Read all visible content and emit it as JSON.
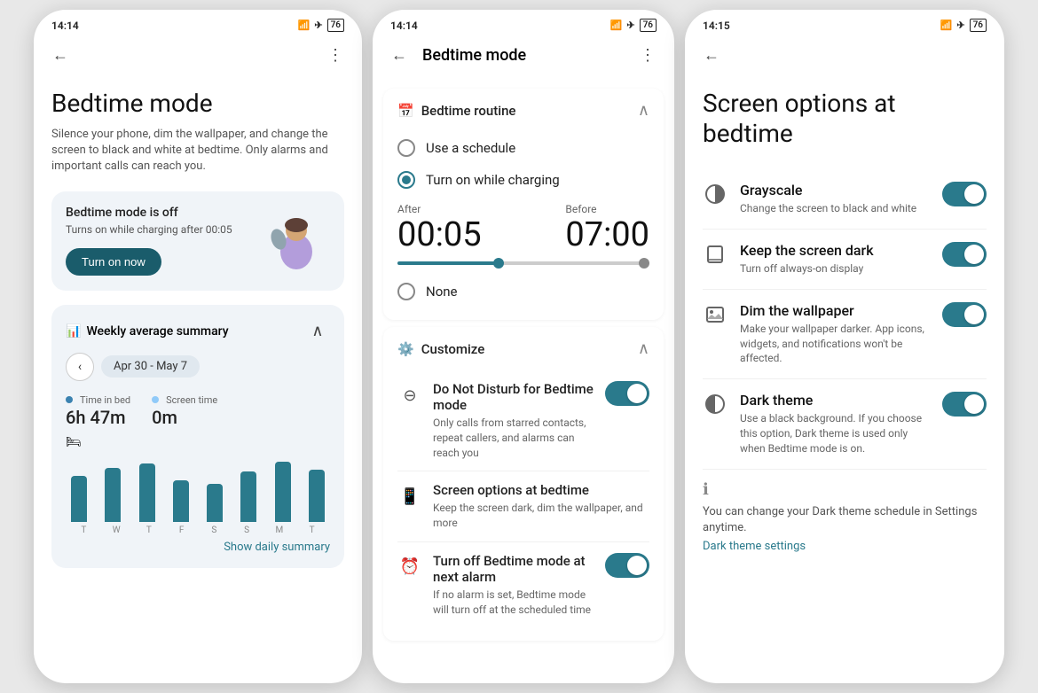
{
  "screen1": {
    "status_time": "14:14",
    "title": "Bedtime mode",
    "description": "Silence your phone, dim the wallpaper, and change the screen to black and white at bedtime. Only alarms and important calls can reach you.",
    "card_status": "Bedtime mode is off",
    "card_sub": "Turns on while charging after 00:05",
    "turn_on_label": "Turn on now",
    "weekly_title": "Weekly average summary",
    "week_range": "Apr 30 - May 7",
    "stat1_label": "Time in bed",
    "stat1_val": "6h 47m",
    "stat2_label": "Screen time",
    "stat2_val": "0m",
    "days": [
      "T",
      "W",
      "T",
      "F",
      "S",
      "S",
      "M",
      "T"
    ],
    "bars": [
      55,
      65,
      70,
      50,
      45,
      60,
      72,
      62
    ],
    "show_daily": "Show daily summary"
  },
  "screen2": {
    "status_time": "14:14",
    "title": "Bedtime mode",
    "section1_title": "Bedtime routine",
    "option1_label": "Use a schedule",
    "option2_label": "Turn on while charging",
    "after_label": "After",
    "before_label": "Before",
    "time_after": "00:05",
    "time_before": "07:00",
    "option3_label": "None",
    "section2_title": "Customize",
    "item1_title": "Do Not Disturb for Bedtime mode",
    "item1_desc": "Only calls from starred contacts, repeat callers, and alarms can reach you",
    "item2_title": "Screen options at bedtime",
    "item2_desc": "Keep the screen dark, dim the wallpaper, and more",
    "item3_title": "Turn off Bedtime mode at next alarm",
    "item3_desc": "If no alarm is set, Bedtime mode will turn off at the scheduled time"
  },
  "screen3": {
    "status_time": "14:15",
    "title": "Screen options at bedtime",
    "opt1_title": "Grayscale",
    "opt1_desc": "Change the screen to black and white",
    "opt2_title": "Keep the screen dark",
    "opt2_desc": "Turn off always-on display",
    "opt3_title": "Dim the wallpaper",
    "opt3_desc": "Make your wallpaper darker. App icons, widgets, and notifications won't be affected.",
    "opt4_title": "Dark theme",
    "opt4_desc": "Use a black background. If you choose this option, Dark theme is used only when Bedtime mode is on.",
    "info_text": "You can change your Dark theme schedule in Settings anytime.",
    "info_link": "Dark theme settings"
  }
}
